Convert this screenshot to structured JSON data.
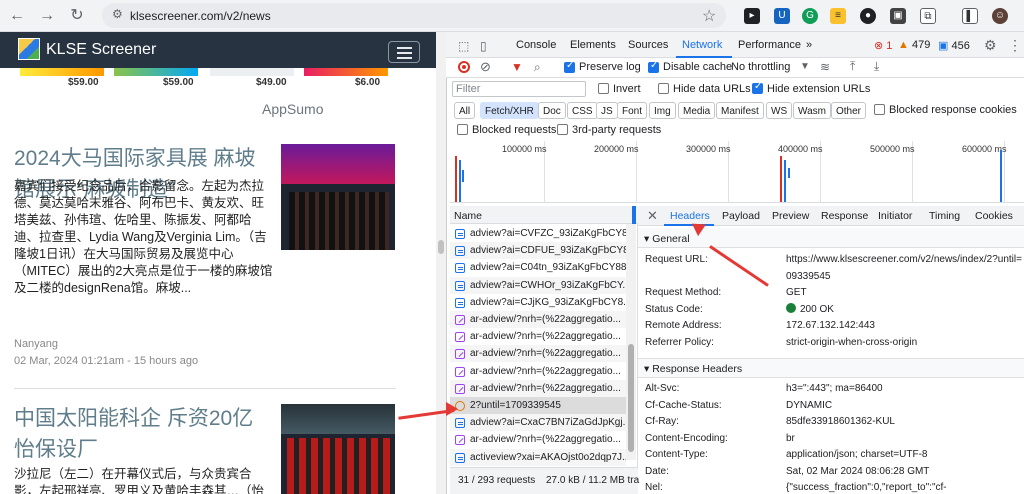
{
  "browser": {
    "url": "klsescreener.com/v2/news"
  },
  "site": {
    "title": "KLSE Screener",
    "prices": [
      "$59.00",
      "$59.00",
      "$49.00",
      "$6.00"
    ],
    "promo": "AppSumo",
    "articles": [
      {
        "title": "2024大马国际家具展 麻坡馆展示“麻坡制造”",
        "body": "嘉宾们接受纪念品后，合影留念。左起为杰拉德、莫达莫哈末雅谷、阿布巴卡、黄友欢、旺塔美兹、孙伟瑄、佐哈里、陈振发、阿都哈迪、拉查里、Lydia Wang及Verginia Lim。（吉隆坡1日讯）在大马国际贸易及展览中心（MITEC）展出的2大亮点是位于一楼的麻坡馆及二楼的designRena馆。麻坡...",
        "source": "Nanyang",
        "time": "02 Mar, 2024 01:21am - 15 hours ago"
      },
      {
        "title": "中国太阳能科企 斥资20亿 怡保设厂",
        "body": "沙拉尼（左二）在开幕仪式后，与众贵宾合影，左起邢祥亮、罗甲义及黄哈丰森其…（怡"
      }
    ]
  },
  "devtools": {
    "tabs": [
      "Console",
      "Elements",
      "Sources",
      "Network",
      "Performance"
    ],
    "active_tab": "Network",
    "errors": "1",
    "warnings": "479",
    "infos": "456",
    "preserve_log": "Preserve log",
    "disable_cache": "Disable cache",
    "throttling": "No throttling",
    "filter_placeholder": "Filter",
    "invert": "Invert",
    "hide_data_urls": "Hide data URLs",
    "hide_ext_urls": "Hide extension URLs",
    "filter_types": [
      "All",
      "Fetch/XHR",
      "Doc",
      "CSS",
      "JS",
      "Font",
      "Img",
      "Media",
      "Manifest",
      "WS",
      "Wasm",
      "Other"
    ],
    "active_filter": "Fetch/XHR",
    "blocked_cookies": "Blocked response cookies",
    "blocked_requests": "Blocked requests",
    "third_party": "3rd-party requests",
    "timeline_ticks": [
      "100000 ms",
      "200000 ms",
      "300000 ms",
      "400000 ms",
      "500000 ms",
      "600000 ms"
    ],
    "name_header": "Name",
    "requests": [
      {
        "name": "adview?ai=CVFZC_93iZaKgFbCY8...",
        "kind": "b"
      },
      {
        "name": "adview?ai=CDFUE_93iZaKgFbCY8...",
        "kind": "b"
      },
      {
        "name": "adview?ai=C04tn_93iZaKgFbCY88...",
        "kind": "b"
      },
      {
        "name": "adview?ai=CWHOr_93iZaKgFbCY...",
        "kind": "b"
      },
      {
        "name": "adview?ai=CJjKG_93iZaKgFbCY8...",
        "kind": "b"
      },
      {
        "name": "ar-adview/?nrh=(%22aggregatio...",
        "kind": "p"
      },
      {
        "name": "ar-adview/?nrh=(%22aggregatio...",
        "kind": "p"
      },
      {
        "name": "ar-adview/?nrh=(%22aggregatio...",
        "kind": "p"
      },
      {
        "name": "ar-adview/?nrh=(%22aggregatio...",
        "kind": "p"
      },
      {
        "name": "ar-adview/?nrh=(%22aggregatio...",
        "kind": "p"
      },
      {
        "name": "2?until=1709339545",
        "kind": "s"
      },
      {
        "name": "adview?ai=CxaC7BN7iZaGdJpKgj...",
        "kind": "b"
      },
      {
        "name": "ar-adview/?nrh=(%22aggregatio...",
        "kind": "p"
      },
      {
        "name": "activeview?xai=AKAOjst0o2dqp7J...",
        "kind": "n"
      }
    ],
    "status_requests": "31 / 293 requests",
    "status_size": "27.0 kB / 11.2 MB tra",
    "detail_tabs": [
      "Headers",
      "Payload",
      "Preview",
      "Response",
      "Initiator",
      "Timing",
      "Cookies"
    ],
    "active_detail": "Headers",
    "general_title": "▾ General",
    "general": [
      {
        "k": "Request URL:",
        "v": "https://www.klsescreener.com/v2/news/index/2?until="
      },
      {
        "k": "",
        "v": "09339545"
      },
      {
        "k": "Request Method:",
        "v": "GET"
      },
      {
        "k": "Status Code:",
        "v": "200 OK"
      },
      {
        "k": "Remote Address:",
        "v": "172.67.132.142:443"
      },
      {
        "k": "Referrer Policy:",
        "v": "strict-origin-when-cross-origin"
      }
    ],
    "response_title": "▾ Response Headers",
    "response": [
      {
        "k": "Alt-Svc:",
        "v": "h3=\":443\"; ma=86400"
      },
      {
        "k": "Cf-Cache-Status:",
        "v": "DYNAMIC"
      },
      {
        "k": "Cf-Ray:",
        "v": "85dfe33918601362-KUL"
      },
      {
        "k": "Content-Encoding:",
        "v": "br"
      },
      {
        "k": "Content-Type:",
        "v": "application/json; charset=UTF-8"
      },
      {
        "k": "Date:",
        "v": "Sat, 02 Mar 2024 08:06:28 GMT"
      },
      {
        "k": "Nel:",
        "v": "{\"success_fraction\":0,\"report_to\":\"cf-"
      }
    ]
  },
  "colors": {
    "accent": "#1a73e8",
    "arrow": "#e53935",
    "site_header": "#273340"
  }
}
